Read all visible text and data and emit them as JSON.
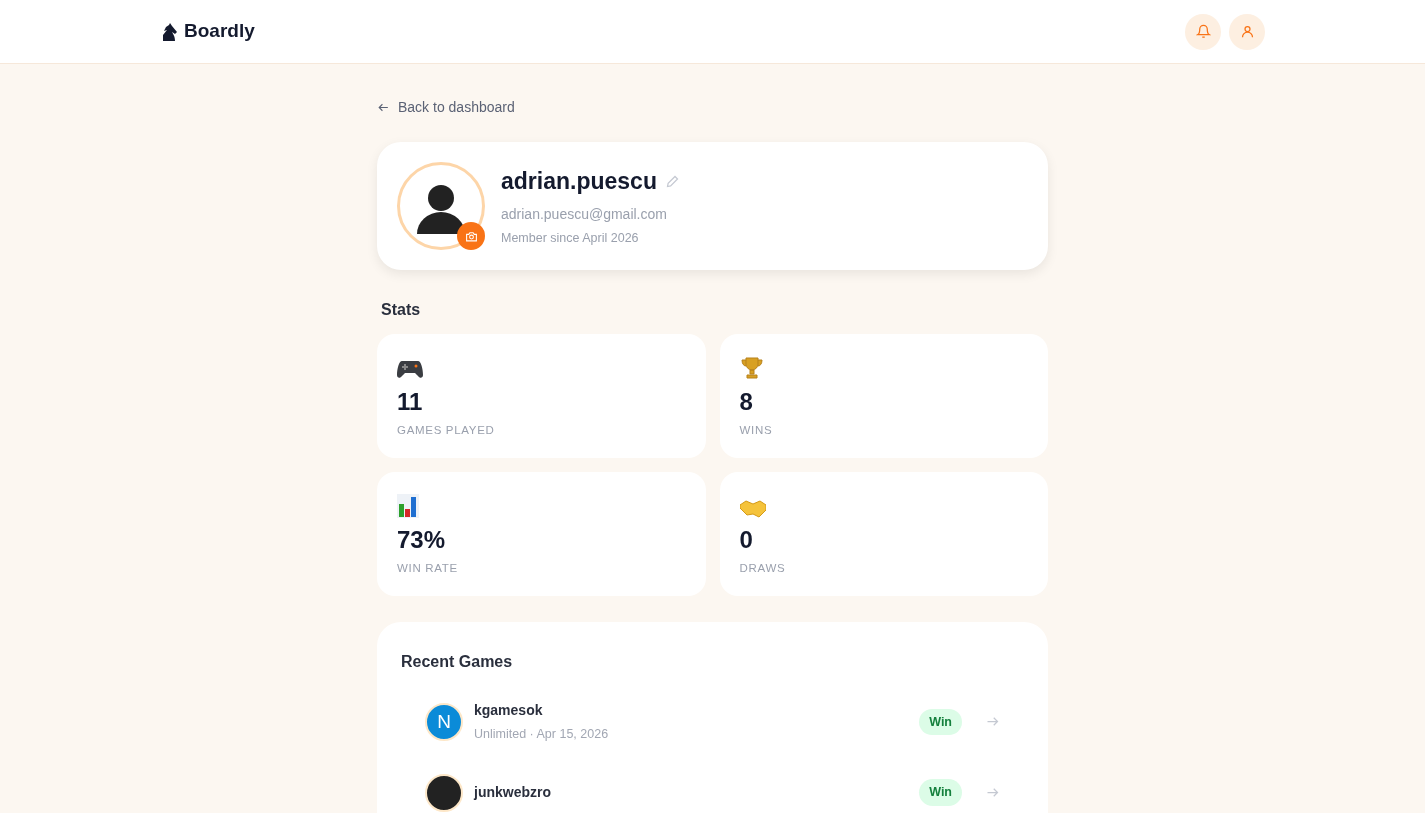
{
  "header": {
    "logo": "Boardly"
  },
  "back_link": "Back to dashboard",
  "profile": {
    "username": "adrian.puescu",
    "email": "adrian.puescu@gmail.com",
    "member_since": "Member since April 2026"
  },
  "stats": {
    "title": "Stats",
    "items": [
      {
        "kind": "gamepad",
        "value": "11",
        "label": "GAMES PLAYED"
      },
      {
        "kind": "trophy",
        "value": "8",
        "label": "WINS"
      },
      {
        "kind": "chart",
        "value": "73%",
        "label": "WIN RATE"
      },
      {
        "kind": "handshake",
        "value": "0",
        "label": "DRAWS"
      }
    ]
  },
  "recent_games": {
    "title": "Recent Games",
    "games": [
      {
        "opponent": "kgamesok",
        "avatar": {
          "kind": "initial",
          "text": "N",
          "color": "#0b8bd8"
        },
        "details": "Unlimited · Apr 15, 2026",
        "result": "Win"
      },
      {
        "opponent": "junkwebzro",
        "avatar": {
          "kind": "photo"
        },
        "result": "Win"
      }
    ]
  }
}
